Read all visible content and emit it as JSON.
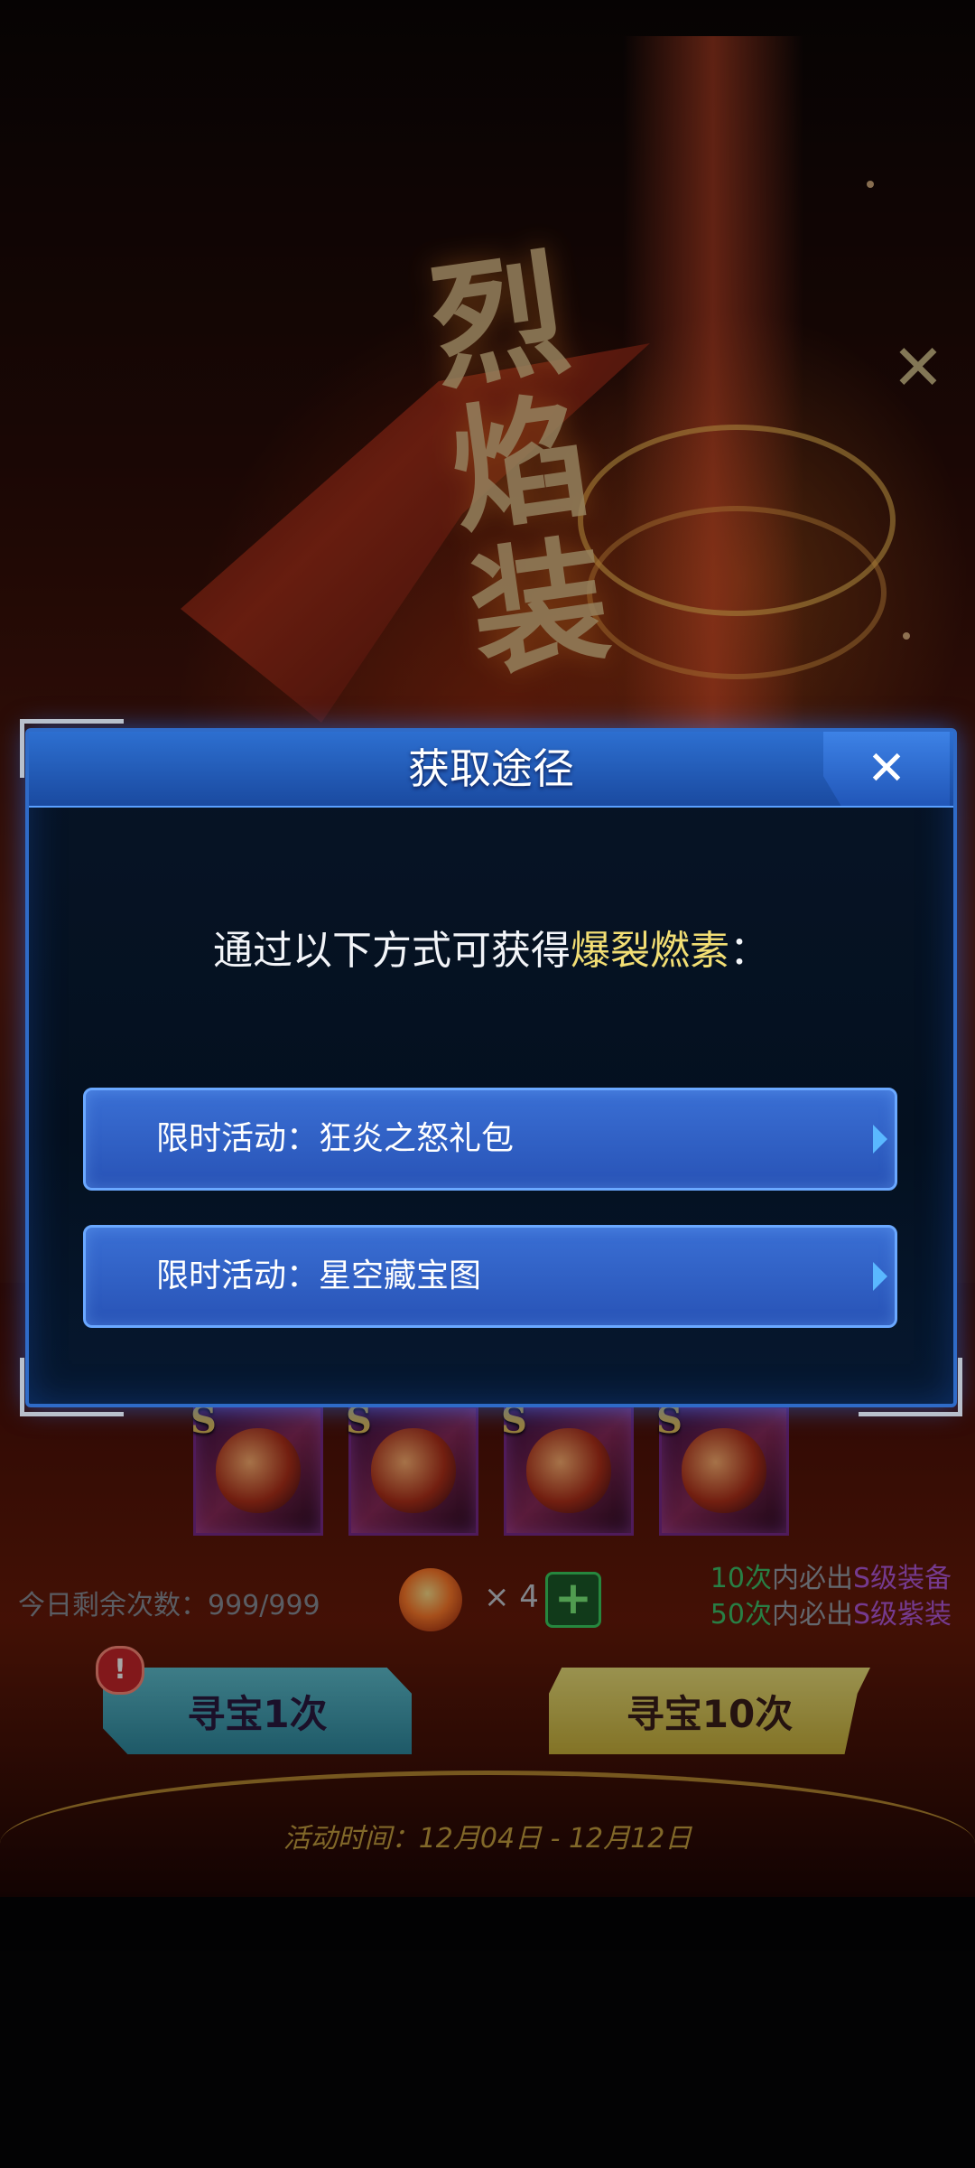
{
  "background": {
    "close_glyph": "✕",
    "banner_art_text": "烈焰装",
    "items": [
      {
        "grade": "S",
        "icon": "fighter-ship-icon"
      },
      {
        "grade": "S",
        "icon": "armor-helmet-icon"
      },
      {
        "grade": "S",
        "icon": "flame-ring-icon"
      },
      {
        "grade": "S",
        "icon": "mech-armor-icon"
      }
    ],
    "remaining_label": "今日剩余次数：999/999",
    "token_multiplier": "× 4",
    "plus_glyph": "+",
    "guarantee": {
      "line1_num": "10次",
      "line1_txt": "内必出",
      "line1_s": "S级装备",
      "line2_num": "50次",
      "line2_txt": "内必出",
      "line2_s": "S级紫装"
    },
    "alert_glyph": "!",
    "button_once": "寻宝1次",
    "button_ten": "寻宝10次",
    "event_time": "活动时间：12月04日 - 12月12日"
  },
  "dialog": {
    "title": "获取途径",
    "close_glyph": "✕",
    "desc_prefix": "通过以下方式可获得",
    "desc_highlight": "爆裂燃素",
    "desc_suffix": "：",
    "options": [
      {
        "label": "限时活动：狂炎之怒礼包"
      },
      {
        "label": "限时活动：星空藏宝图"
      }
    ]
  },
  "colors": {
    "dialog_border": "#2f6bc8",
    "highlight": "#f2de74",
    "button_cyan": "#5fc0d0",
    "button_yellow": "#ece07a"
  }
}
